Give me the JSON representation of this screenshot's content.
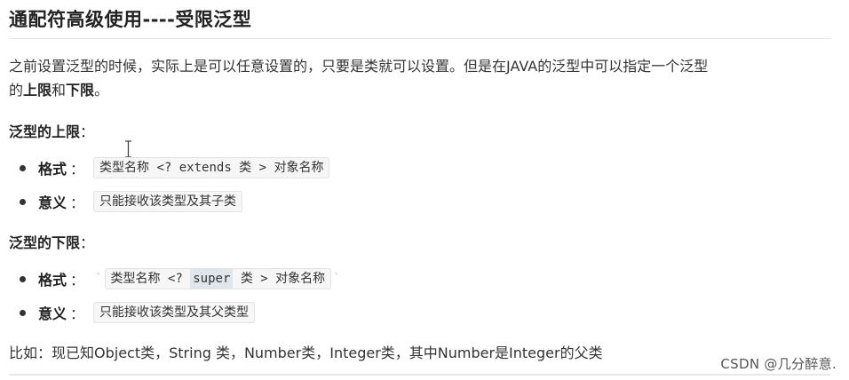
{
  "title": "通配符高级使用----受限泛型",
  "intro": {
    "line1": "之前设置泛型的时候，实际上是可以任意设置的，只要是类就可以设置。但是在JAVA的泛型中可以指定一个泛型",
    "line2_prefix": "的",
    "upper": "上限",
    "and": "和",
    "lower": "下限",
    "period": "。"
  },
  "upper_section": {
    "heading": "泛型的上限",
    "colon": "：",
    "format_label": "格式",
    "format_colon": "：",
    "format_code": "类型名称 <? extends 类 > 对象名称",
    "meaning_label": "意义",
    "meaning_colon": "：",
    "meaning_code": "只能接收该类型及其子类"
  },
  "lower_section": {
    "heading": "泛型的下限",
    "colon": "：",
    "format_label": "格式",
    "format_colon": "：",
    "tick": "`",
    "format_code_pre": "类型名称 <? ",
    "format_code_hl": "super",
    "format_code_post": " 类 > 对象名称",
    "meaning_label": "意义",
    "meaning_colon": "：",
    "meaning_code": "只能接收该类型及其父类型"
  },
  "summary": "比如：现已知Object类，String 类，Number类，Integer类，其中Number是Integer的父类",
  "watermark": "CSDN @几分醉意.",
  "icons": {
    "cursor": "text-cursor-icon"
  }
}
